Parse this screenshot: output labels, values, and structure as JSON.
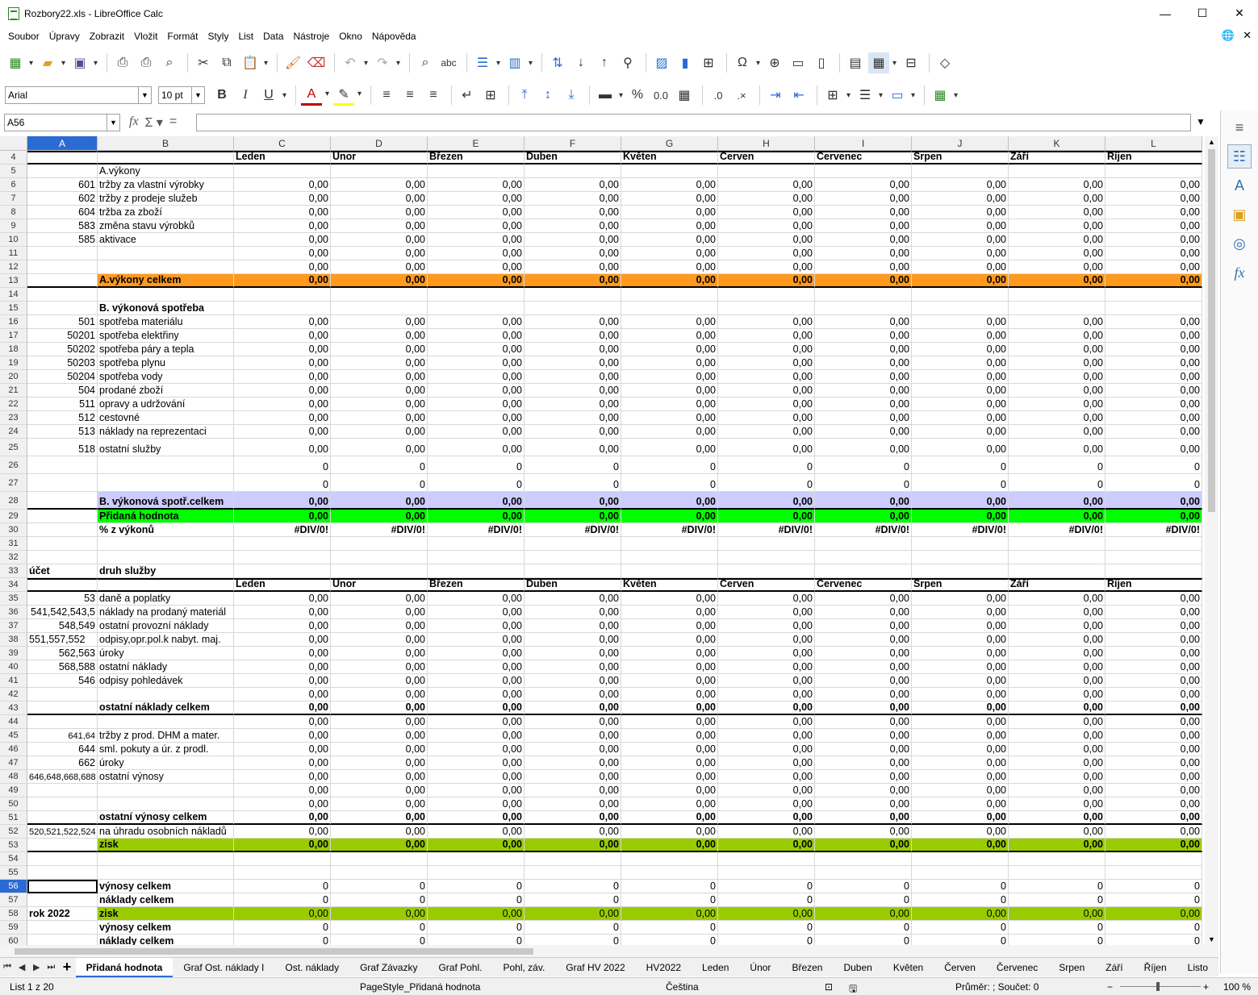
{
  "window": {
    "title": "Rozbory22.xls - LibreOffice Calc",
    "minimize": "—",
    "maximize": "☐",
    "close": "✕"
  },
  "menu": [
    "Soubor",
    "Úpravy",
    "Zobrazit",
    "Vložit",
    "Formát",
    "Styly",
    "List",
    "Data",
    "Nástroje",
    "Okno",
    "Nápověda"
  ],
  "formatting": {
    "font_name": "Arial",
    "font_size": "10 pt"
  },
  "formula_bar": {
    "cell_ref": "A56",
    "content": ""
  },
  "columns": [
    "A",
    "B",
    "C",
    "D",
    "E",
    "F",
    "G",
    "H",
    "I",
    "J",
    "K",
    "L"
  ],
  "selected_column": "A",
  "selected_row": "56",
  "rows": [
    {
      "n": "4",
      "a": "",
      "b": "",
      "vals": [
        "Leden",
        "Únor",
        "Březen",
        "Duben",
        "Květen",
        "Červen",
        "Červenec",
        "Srpen",
        "Září",
        "Říjen"
      ],
      "type": "header"
    },
    {
      "n": "5",
      "a": "",
      "b": "A.výkony",
      "vals": [],
      "type": "plain"
    },
    {
      "n": "6",
      "a": "601",
      "b": "tržby za vlastní výrobky",
      "vals": [
        "0,00",
        "0,00",
        "0,00",
        "0,00",
        "0,00",
        "0,00",
        "0,00",
        "0,00",
        "0,00",
        "0,00"
      ],
      "type": "plain"
    },
    {
      "n": "7",
      "a": "602",
      "b": "tržby z prodeje služeb",
      "vals": [
        "0,00",
        "0,00",
        "0,00",
        "0,00",
        "0,00",
        "0,00",
        "0,00",
        "0,00",
        "0,00",
        "0,00"
      ],
      "type": "plain"
    },
    {
      "n": "8",
      "a": "604",
      "b": "tržba za zboží",
      "vals": [
        "0,00",
        "0,00",
        "0,00",
        "0,00",
        "0,00",
        "0,00",
        "0,00",
        "0,00",
        "0,00",
        "0,00"
      ],
      "type": "plain"
    },
    {
      "n": "9",
      "a": "583",
      "b": "změna stavu výrobků",
      "vals": [
        "0,00",
        "0,00",
        "0,00",
        "0,00",
        "0,00",
        "0,00",
        "0,00",
        "0,00",
        "0,00",
        "0,00"
      ],
      "type": "plain"
    },
    {
      "n": "10",
      "a": "585",
      "b": "aktivace",
      "vals": [
        "0,00",
        "0,00",
        "0,00",
        "0,00",
        "0,00",
        "0,00",
        "0,00",
        "0,00",
        "0,00",
        "0,00"
      ],
      "type": "plain"
    },
    {
      "n": "11",
      "a": "",
      "b": "",
      "vals": [
        "0,00",
        "0,00",
        "0,00",
        "0,00",
        "0,00",
        "0,00",
        "0,00",
        "0,00",
        "0,00",
        "0,00"
      ],
      "type": "plain"
    },
    {
      "n": "12",
      "a": "",
      "b": "",
      "vals": [
        "0,00",
        "0,00",
        "0,00",
        "0,00",
        "0,00",
        "0,00",
        "0,00",
        "0,00",
        "0,00",
        "0,00"
      ],
      "type": "plain"
    },
    {
      "n": "13",
      "a": "",
      "b": "A.výkony celkem",
      "vals": [
        "0,00",
        "0,00",
        "0,00",
        "0,00",
        "0,00",
        "0,00",
        "0,00",
        "0,00",
        "0,00",
        "0,00"
      ],
      "type": "orange"
    },
    {
      "n": "14",
      "a": "",
      "b": "",
      "vals": [],
      "type": "plain"
    },
    {
      "n": "15",
      "a": "",
      "b": "B. výkonová spotřeba",
      "vals": [],
      "type": "boldlabel"
    },
    {
      "n": "16",
      "a": "501",
      "b": "spotřeba materiálu",
      "vals": [
        "0,00",
        "0,00",
        "0,00",
        "0,00",
        "0,00",
        "0,00",
        "0,00",
        "0,00",
        "0,00",
        "0,00"
      ],
      "type": "plain"
    },
    {
      "n": "17",
      "a": "50201",
      "b": "spotřeba elektřiny",
      "vals": [
        "0,00",
        "0,00",
        "0,00",
        "0,00",
        "0,00",
        "0,00",
        "0,00",
        "0,00",
        "0,00",
        "0,00"
      ],
      "type": "plain"
    },
    {
      "n": "18",
      "a": "50202",
      "b": "spotřeba páry a tepla",
      "vals": [
        "0,00",
        "0,00",
        "0,00",
        "0,00",
        "0,00",
        "0,00",
        "0,00",
        "0,00",
        "0,00",
        "0,00"
      ],
      "type": "plain"
    },
    {
      "n": "19",
      "a": "50203",
      "b": "spotřeba plynu",
      "vals": [
        "0,00",
        "0,00",
        "0,00",
        "0,00",
        "0,00",
        "0,00",
        "0,00",
        "0,00",
        "0,00",
        "0,00"
      ],
      "type": "plain"
    },
    {
      "n": "20",
      "a": "50204",
      "b": "spotřeba vody",
      "vals": [
        "0,00",
        "0,00",
        "0,00",
        "0,00",
        "0,00",
        "0,00",
        "0,00",
        "0,00",
        "0,00",
        "0,00"
      ],
      "type": "plain"
    },
    {
      "n": "21",
      "a": "504",
      "b": "prodané zboží",
      "vals": [
        "0,00",
        "0,00",
        "0,00",
        "0,00",
        "0,00",
        "0,00",
        "0,00",
        "0,00",
        "0,00",
        "0,00"
      ],
      "type": "plain"
    },
    {
      "n": "22",
      "a": "511",
      "b": "opravy a udržování",
      "vals": [
        "0,00",
        "0,00",
        "0,00",
        "0,00",
        "0,00",
        "0,00",
        "0,00",
        "0,00",
        "0,00",
        "0,00"
      ],
      "type": "plain"
    },
    {
      "n": "23",
      "a": "512",
      "b": "cestovné",
      "vals": [
        "0,00",
        "0,00",
        "0,00",
        "0,00",
        "0,00",
        "0,00",
        "0,00",
        "0,00",
        "0,00",
        "0,00"
      ],
      "type": "plain"
    },
    {
      "n": "24",
      "a": "513",
      "b": "náklady na reprezentaci",
      "vals": [
        "0,00",
        "0,00",
        "0,00",
        "0,00",
        "0,00",
        "0,00",
        "0,00",
        "0,00",
        "0,00",
        "0,00"
      ],
      "type": "plain"
    },
    {
      "n": "25",
      "a": "518",
      "b": "ostatní služby",
      "vals": [
        "0,00",
        "0,00",
        "0,00",
        "0,00",
        "0,00",
        "0,00",
        "0,00",
        "0,00",
        "0,00",
        "0,00"
      ],
      "type": "plain",
      "tall": true
    },
    {
      "n": "26",
      "a": "",
      "b": "",
      "vals": [
        "0",
        "0",
        "0",
        "0",
        "0",
        "0",
        "0",
        "0",
        "0",
        "0"
      ],
      "type": "plain",
      "tall": true
    },
    {
      "n": "27",
      "a": "",
      "b": "",
      "vals": [
        "0",
        "0",
        "0",
        "0",
        "0",
        "0",
        "0",
        "0",
        "0",
        "0"
      ],
      "type": "plain",
      "tall": true
    },
    {
      "n": "28",
      "a": "",
      "b": "B. výkonová spotř.celkem",
      "vals": [
        "0,00",
        "0,00",
        "0,00",
        "0,00",
        "0,00",
        "0,00",
        "0,00",
        "0,00",
        "0,00",
        "0,00"
      ],
      "type": "lavender",
      "tall": true
    },
    {
      "n": "29",
      "a": "",
      "b": "Přidaná hodnota",
      "vals": [
        "0,00",
        "0,00",
        "0,00",
        "0,00",
        "0,00",
        "0,00",
        "0,00",
        "0,00",
        "0,00",
        "0,00"
      ],
      "type": "green"
    },
    {
      "n": "30",
      "a": "",
      "b": "% z výkonů",
      "vals": [
        "#DIV/0!",
        "#DIV/0!",
        "#DIV/0!",
        "#DIV/0!",
        "#DIV/0!",
        "#DIV/0!",
        "#DIV/0!",
        "#DIV/0!",
        "#DIV/0!",
        "#DIV/0!"
      ],
      "type": "boldlabel"
    },
    {
      "n": "31",
      "a": "",
      "b": "",
      "vals": [],
      "type": "plain"
    },
    {
      "n": "32",
      "a": "",
      "b": "",
      "vals": [],
      "type": "plain"
    },
    {
      "n": "33",
      "a": "účet",
      "b": "druh služby",
      "vals": [],
      "type": "boldlabel",
      "aleft": true
    },
    {
      "n": "34",
      "a": "",
      "b": "",
      "vals": [
        "Leden",
        "Únor",
        "Březen",
        "Duben",
        "Květen",
        "Červen",
        "Červenec",
        "Srpen",
        "Září",
        "Říjen"
      ],
      "type": "header"
    },
    {
      "n": "35",
      "a": "53",
      "b": "daně a poplatky",
      "vals": [
        "0,00",
        "0,00",
        "0,00",
        "0,00",
        "0,00",
        "0,00",
        "0,00",
        "0,00",
        "0,00",
        "0,00"
      ],
      "type": "plain"
    },
    {
      "n": "36",
      "a": "541,542,543,5",
      "b": "náklady na prodaný materiál",
      "vals": [
        "0,00",
        "0,00",
        "0,00",
        "0,00",
        "0,00",
        "0,00",
        "0,00",
        "0,00",
        "0,00",
        "0,00"
      ],
      "type": "plain"
    },
    {
      "n": "37",
      "a": "548,549",
      "b": "ostatní provozní náklady",
      "vals": [
        "0,00",
        "0,00",
        "0,00",
        "0,00",
        "0,00",
        "0,00",
        "0,00",
        "0,00",
        "0,00",
        "0,00"
      ],
      "type": "plain"
    },
    {
      "n": "38",
      "a": "551,557,552",
      "b": "odpisy,opr.pol.k nabyt. maj.",
      "vals": [
        "0,00",
        "0,00",
        "0,00",
        "0,00",
        "0,00",
        "0,00",
        "0,00",
        "0,00",
        "0,00",
        "0,00"
      ],
      "type": "plain",
      "aleft": true
    },
    {
      "n": "39",
      "a": "562,563",
      "b": "úroky",
      "vals": [
        "0,00",
        "0,00",
        "0,00",
        "0,00",
        "0,00",
        "0,00",
        "0,00",
        "0,00",
        "0,00",
        "0,00"
      ],
      "type": "plain"
    },
    {
      "n": "40",
      "a": "568,588",
      "b": "ostatní náklady",
      "vals": [
        "0,00",
        "0,00",
        "0,00",
        "0,00",
        "0,00",
        "0,00",
        "0,00",
        "0,00",
        "0,00",
        "0,00"
      ],
      "type": "plain"
    },
    {
      "n": "41",
      "a": "546",
      "b": "odpisy pohledávek",
      "vals": [
        "0,00",
        "0,00",
        "0,00",
        "0,00",
        "0,00",
        "0,00",
        "0,00",
        "0,00",
        "0,00",
        "0,00"
      ],
      "type": "plain"
    },
    {
      "n": "42",
      "a": "",
      "b": "",
      "vals": [
        "0,00",
        "0,00",
        "0,00",
        "0,00",
        "0,00",
        "0,00",
        "0,00",
        "0,00",
        "0,00",
        "0,00"
      ],
      "type": "plain"
    },
    {
      "n": "43",
      "a": "",
      "b": "ostatní náklady celkem",
      "vals": [
        "0,00",
        "0,00",
        "0,00",
        "0,00",
        "0,00",
        "0,00",
        "0,00",
        "0,00",
        "0,00",
        "0,00"
      ],
      "type": "boldtotal"
    },
    {
      "n": "44",
      "a": "",
      "b": "",
      "vals": [
        "0,00",
        "0,00",
        "0,00",
        "0,00",
        "0,00",
        "0,00",
        "0,00",
        "0,00",
        "0,00",
        "0,00"
      ],
      "type": "plain"
    },
    {
      "n": "45",
      "a": "641,64",
      "b": "tržby z prod. DHM a mater.",
      "vals": [
        "0,00",
        "0,00",
        "0,00",
        "0,00",
        "0,00",
        "0,00",
        "0,00",
        "0,00",
        "0,00",
        "0,00"
      ],
      "type": "plain",
      "asmall": true
    },
    {
      "n": "46",
      "a": "644",
      "b": "sml. pokuty a úr. z prodl.",
      "vals": [
        "0,00",
        "0,00",
        "0,00",
        "0,00",
        "0,00",
        "0,00",
        "0,00",
        "0,00",
        "0,00",
        "0,00"
      ],
      "type": "plain"
    },
    {
      "n": "47",
      "a": "662",
      "b": "úroky",
      "vals": [
        "0,00",
        "0,00",
        "0,00",
        "0,00",
        "0,00",
        "0,00",
        "0,00",
        "0,00",
        "0,00",
        "0,00"
      ],
      "type": "plain"
    },
    {
      "n": "48",
      "a": "646,648,668,688",
      "b": "ostatní výnosy",
      "vals": [
        "0,00",
        "0,00",
        "0,00",
        "0,00",
        "0,00",
        "0,00",
        "0,00",
        "0,00",
        "0,00",
        "0,00"
      ],
      "type": "plain",
      "asmall": true,
      "aleft": true
    },
    {
      "n": "49",
      "a": "",
      "b": "",
      "vals": [
        "0,00",
        "0,00",
        "0,00",
        "0,00",
        "0,00",
        "0,00",
        "0,00",
        "0,00",
        "0,00",
        "0,00"
      ],
      "type": "plain"
    },
    {
      "n": "50",
      "a": "",
      "b": "",
      "vals": [
        "0,00",
        "0,00",
        "0,00",
        "0,00",
        "0,00",
        "0,00",
        "0,00",
        "0,00",
        "0,00",
        "0,00"
      ],
      "type": "plain"
    },
    {
      "n": "51",
      "a": "",
      "b": "ostatní výnosy celkem",
      "vals": [
        "0,00",
        "0,00",
        "0,00",
        "0,00",
        "0,00",
        "0,00",
        "0,00",
        "0,00",
        "0,00",
        "0,00"
      ],
      "type": "boldtotal"
    },
    {
      "n": "52",
      "a": "520,521,522,524",
      "b": "na úhradu osobních nákladů",
      "vals": [
        "0,00",
        "0,00",
        "0,00",
        "0,00",
        "0,00",
        "0,00",
        "0,00",
        "0,00",
        "0,00",
        "0,00"
      ],
      "type": "plain",
      "asmall": true,
      "aleft": true
    },
    {
      "n": "53",
      "a": "",
      "b": "zisk",
      "vals": [
        "0,00",
        "0,00",
        "0,00",
        "0,00",
        "0,00",
        "0,00",
        "0,00",
        "0,00",
        "0,00",
        "0,00"
      ],
      "type": "olive"
    },
    {
      "n": "54",
      "a": "",
      "b": "",
      "vals": [],
      "type": "plain"
    },
    {
      "n": "55",
      "a": "",
      "b": "",
      "vals": [],
      "type": "plain"
    },
    {
      "n": "56",
      "a": "",
      "b": "výnosy celkem",
      "vals": [
        "0",
        "0",
        "0",
        "0",
        "0",
        "0",
        "0",
        "0",
        "0",
        "0"
      ],
      "type": "boldlabel"
    },
    {
      "n": "57",
      "a": "",
      "b": "náklady celkem",
      "vals": [
        "0",
        "0",
        "0",
        "0",
        "0",
        "0",
        "0",
        "0",
        "0",
        "0"
      ],
      "type": "boldlabel"
    },
    {
      "n": "58",
      "a": "rok 2022",
      "b": "zisk",
      "vals": [
        "0,00",
        "0,00",
        "0,00",
        "0,00",
        "0,00",
        "0,00",
        "0,00",
        "0,00",
        "0,00",
        "0,00"
      ],
      "type": "olive2",
      "aleft": true
    },
    {
      "n": "59",
      "a": "",
      "b": "výnosy celkem",
      "vals": [
        "0",
        "0",
        "0",
        "0",
        "0",
        "0",
        "0",
        "0",
        "0",
        "0"
      ],
      "type": "boldlabel"
    },
    {
      "n": "60",
      "a": "",
      "b": "náklady celkem",
      "vals": [
        "0",
        "0",
        "0",
        "0",
        "0",
        "0",
        "0",
        "0",
        "0",
        "0"
      ],
      "type": "boldlabel"
    }
  ],
  "sheet_tabs": [
    "Přidaná hodnota",
    "Graf Ost. náklady I",
    "Ost. náklady",
    "Graf Závazky",
    "Graf Pohl.",
    "Pohl, záv.",
    "Graf HV 2022",
    "HV2022",
    "Leden",
    "Únor",
    "Březen",
    "Duben",
    "Květen",
    "Červen",
    "Červenec",
    "Srpen",
    "Září",
    "Říjen",
    "Listo"
  ],
  "active_tab": "Přidaná hodnota",
  "status": {
    "sheet": "List 1 z 20",
    "page_style": "PageStyle_Přidaná hodnota",
    "language": "Čeština",
    "sum": "Průměr: ; Součet: 0",
    "zoom": "100 %"
  },
  "colors": {
    "orange": "#ff9a1e",
    "lavender": "#ccccff",
    "green": "#00ff00",
    "olive": "#99cc00",
    "selection": "#2a6bd3"
  }
}
